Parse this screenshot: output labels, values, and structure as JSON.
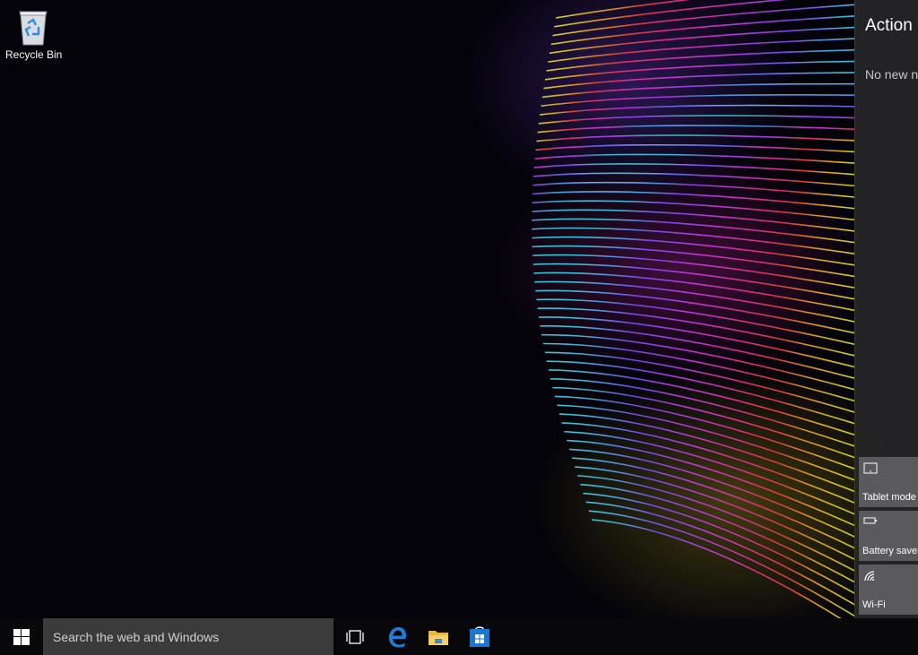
{
  "desktop": {
    "recycle_bin_label": "Recycle Bin"
  },
  "action_center": {
    "title": "Action",
    "empty_message": "No new n",
    "quick_actions": [
      {
        "label": "Tablet mode",
        "icon": "tablet-mode-icon"
      },
      {
        "label": "Battery saver",
        "icon": "battery-icon"
      },
      {
        "label": "Wi-Fi",
        "icon": "wifi-icon"
      }
    ]
  },
  "taskbar": {
    "search_placeholder": "Search the web and Windows",
    "pinned": [
      {
        "name": "Task View",
        "icon": "task-view-icon"
      },
      {
        "name": "Microsoft Edge",
        "icon": "edge-icon"
      },
      {
        "name": "File Explorer",
        "icon": "file-explorer-icon"
      },
      {
        "name": "Store",
        "icon": "store-icon"
      }
    ]
  },
  "colors": {
    "windows_blue": "#0078d7",
    "folder_yellow": "#e8b84a"
  }
}
